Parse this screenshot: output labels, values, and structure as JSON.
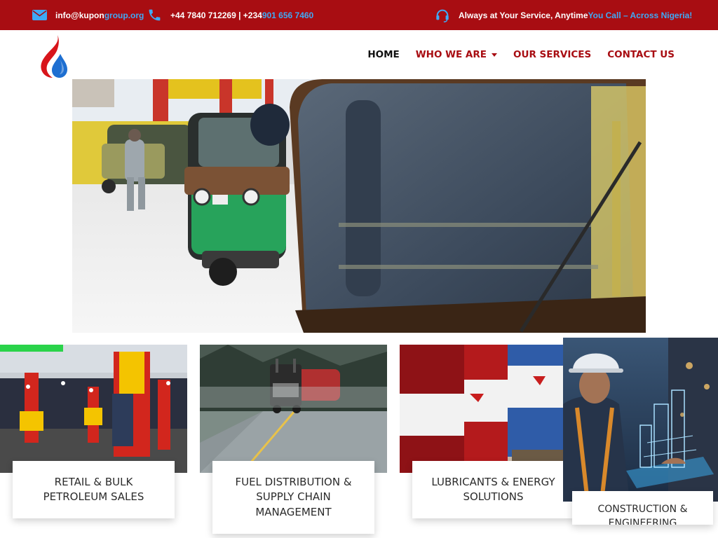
{
  "topbar": {
    "email_prefix": "info@kupon",
    "email_suffix": "group.org",
    "phone_main": "+44 7840 712269 | +234 ",
    "phone_accent": "901 656 7460",
    "support_main": "Always at Your Service, Anytime ",
    "support_accent": "You Call – Across Nigeria!",
    "icons": {
      "email": "envelope-icon",
      "phone": "phone-icon",
      "support": "headset-icon"
    },
    "colors": {
      "background": "#a80d12",
      "accent": "#3fa9f5",
      "text": "#ffffff"
    }
  },
  "nav": {
    "items": [
      {
        "label": "HOME",
        "active": true
      },
      {
        "label": "WHO WE ARE",
        "dropdown": true
      },
      {
        "label": "OUR SERVICES"
      },
      {
        "label": "CONTACT US"
      }
    ],
    "colors": {
      "active": "#111111",
      "default": "#a80d12"
    }
  },
  "logo": {
    "icon": "flame-droplet-logo",
    "colors": [
      "#d8151b",
      "#1e6fd1"
    ]
  },
  "services": [
    {
      "line1": "RETAIL & BULK",
      "line2": "PETROLEUM SALES",
      "line3": ""
    },
    {
      "line1": "FUEL DISTRIBUTION &",
      "line2": "SUPPLY CHAIN",
      "line3": "MANAGEMENT"
    },
    {
      "line1": "LUBRICANTS & ENERGY",
      "line2": "SOLUTIONS",
      "line3": ""
    },
    {
      "line1": "CONSTRUCTION &",
      "line2": "ENGINEERING",
      "line3": ""
    }
  ]
}
